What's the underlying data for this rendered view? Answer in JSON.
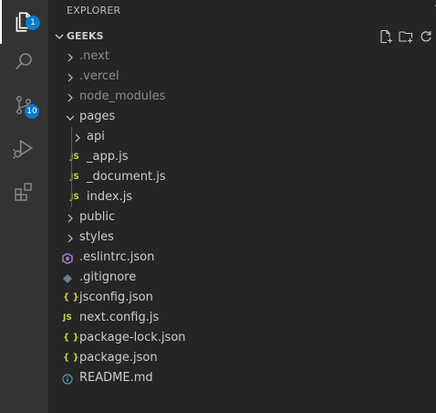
{
  "activity_bar": {
    "explorer_badge": "1",
    "source_control_badge": "10"
  },
  "explorer": {
    "title": "EXPLORER",
    "section": "GEEKS",
    "items": [
      {
        "label": ".next",
        "type": "folder",
        "expanded": false,
        "dim": true
      },
      {
        "label": ".vercel",
        "type": "folder",
        "expanded": false,
        "dim": true
      },
      {
        "label": "node_modules",
        "type": "folder",
        "expanded": false,
        "dim": true
      },
      {
        "label": "pages",
        "type": "folder",
        "expanded": true
      },
      {
        "label": "api",
        "type": "folder",
        "expanded": false
      },
      {
        "label": "_app.js",
        "type": "js",
        "icon": "JS"
      },
      {
        "label": "_document.js",
        "type": "js",
        "icon": "JS"
      },
      {
        "label": "index.js",
        "type": "js",
        "icon": "JS"
      },
      {
        "label": "public",
        "type": "folder",
        "expanded": false
      },
      {
        "label": "styles",
        "type": "folder",
        "expanded": false
      },
      {
        "label": ".eslintrc.json",
        "type": "eslint"
      },
      {
        "label": ".gitignore",
        "type": "git"
      },
      {
        "label": "jsconfig.json",
        "type": "json",
        "icon": "{ }"
      },
      {
        "label": "next.config.js",
        "type": "js",
        "icon": "JS"
      },
      {
        "label": "package-lock.json",
        "type": "json",
        "icon": "{ }"
      },
      {
        "label": "package.json",
        "type": "json",
        "icon": "{ }"
      },
      {
        "label": "README.md",
        "type": "info"
      }
    ]
  },
  "colors": {
    "js": "#cbcb41",
    "json": "#cbcb41",
    "eslint": "#a074c4",
    "git": "#41535b",
    "info": "#519aba",
    "badge": "#007acc"
  }
}
